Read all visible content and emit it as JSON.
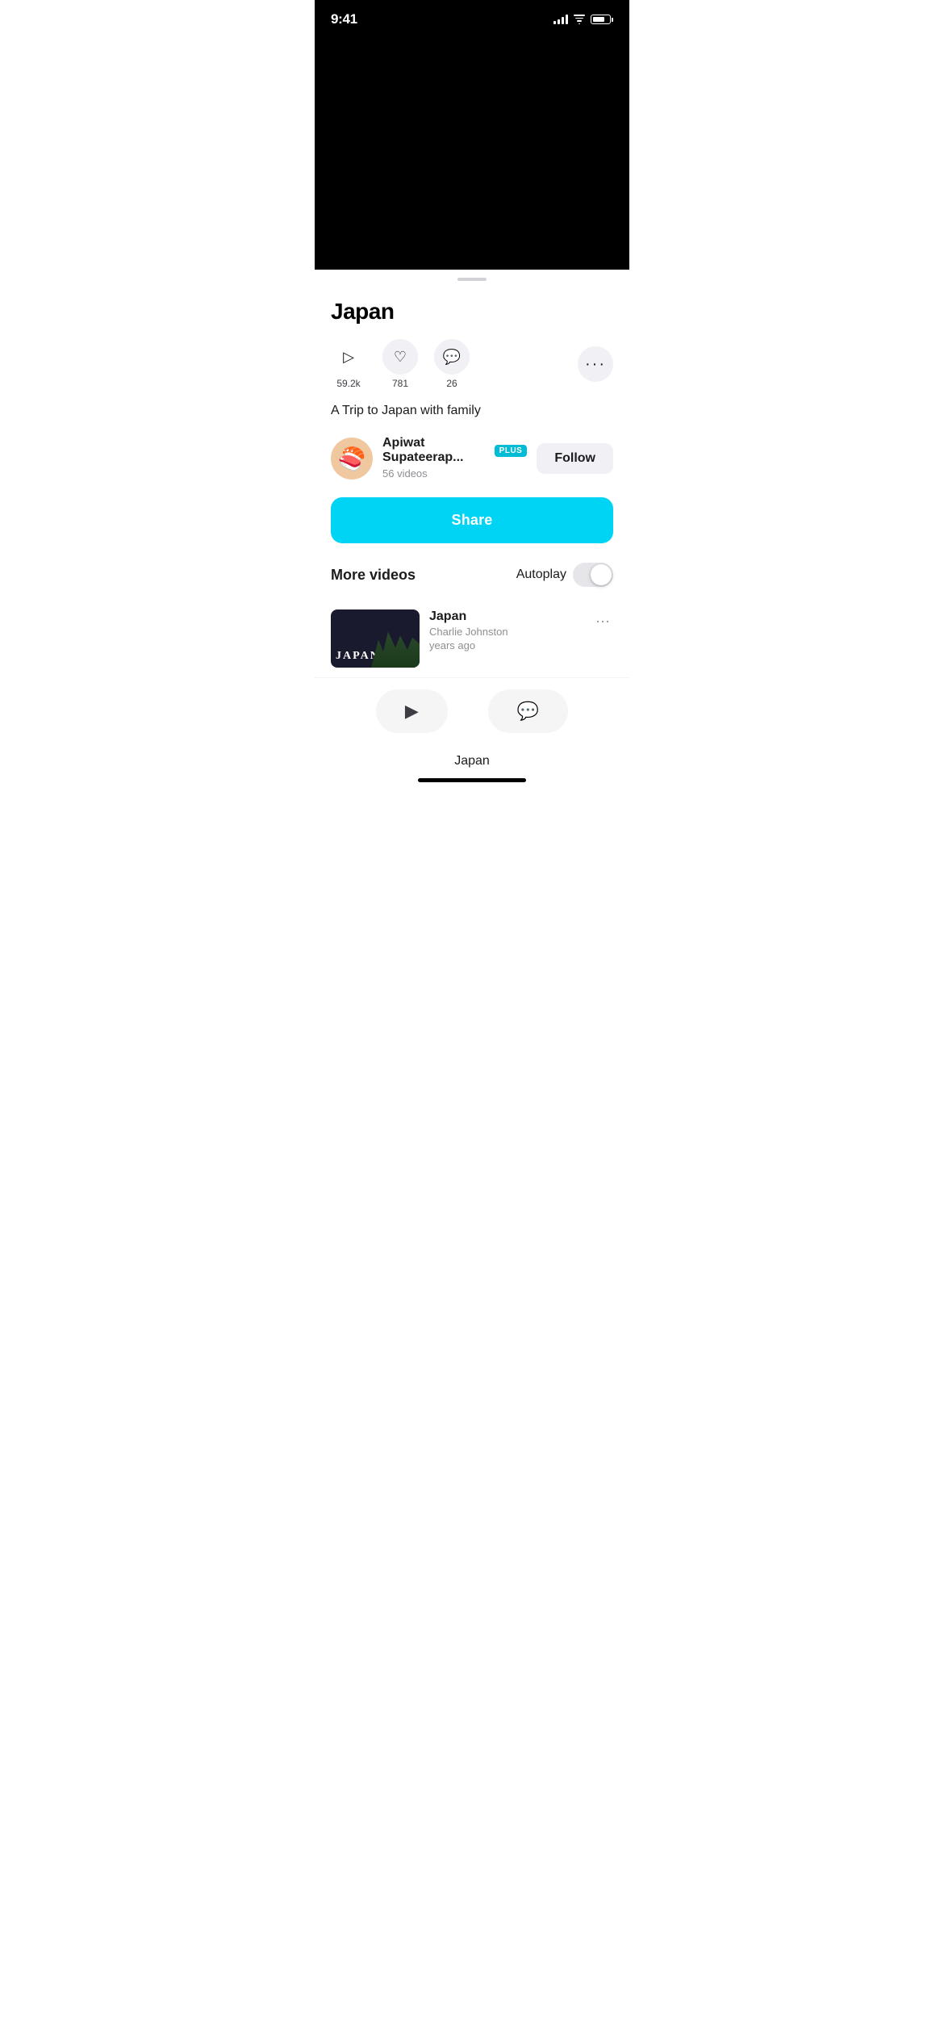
{
  "statusBar": {
    "time": "9:41"
  },
  "video": {
    "title": "Japan",
    "stats": {
      "plays": "59.2k",
      "likes": "781",
      "comments": "26"
    },
    "description": "A Trip to Japan with family"
  },
  "author": {
    "name": "Apiwat Supateerap...",
    "badge": "PLUS",
    "videoCount": "56 videos"
  },
  "buttons": {
    "follow": "Follow",
    "share": "Share"
  },
  "moreVideos": {
    "title": "More videos",
    "autoplay": "Autoplay"
  },
  "videoListItem": {
    "title": "Japan",
    "author": "Charlie Johnston",
    "meta": "years ago"
  },
  "bottomTitle": "Japan"
}
